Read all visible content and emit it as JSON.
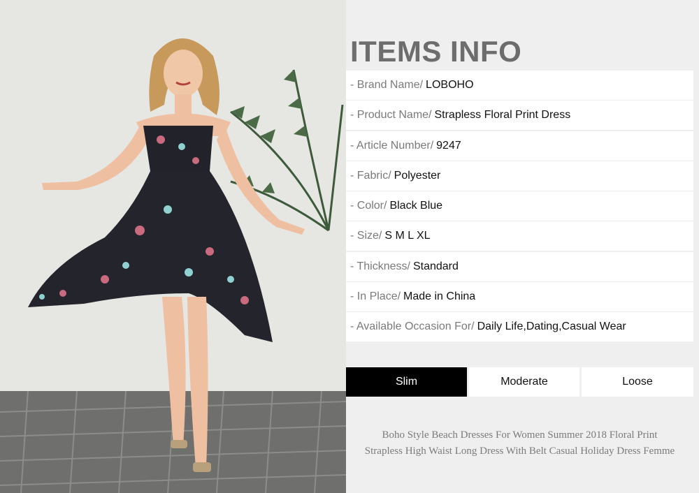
{
  "photo": {
    "alt_icon": "model-photo"
  },
  "title": "ITEMS INFO",
  "rows": [
    {
      "label": "- Brand Name/",
      "value": "LOBOHO"
    },
    {
      "label": "- Product Name/",
      "value": "Strapless Floral Print Dress"
    },
    {
      "label": "- Article Number/",
      "value": "9247"
    },
    {
      "label": "- Fabric/",
      "value": "Polyester"
    },
    {
      "label": "- Color/",
      "value": "Black Blue"
    },
    {
      "label": "- Size/",
      "value": "S M L XL"
    },
    {
      "label": "- Thickness/",
      "value": "Standard"
    },
    {
      "label": "- In Place/",
      "value": "Made in China"
    },
    {
      "label": "- Available Occasion For/",
      "value": "Daily Life,Dating,Casual Wear"
    }
  ],
  "fit": {
    "slim": "Slim",
    "moderate": "Moderate",
    "loose": "Loose",
    "selected": "Slim"
  },
  "description": {
    "line1": "Boho Style Beach Dresses For Women Summer 2018 Floral Print",
    "line2": "Strapless High Waist Long Dress With Belt Casual Holiday Dress Femme"
  },
  "colors": {
    "panel_bg": "#efefef",
    "title": "#6d6d6d",
    "active_fit": "#000000"
  }
}
